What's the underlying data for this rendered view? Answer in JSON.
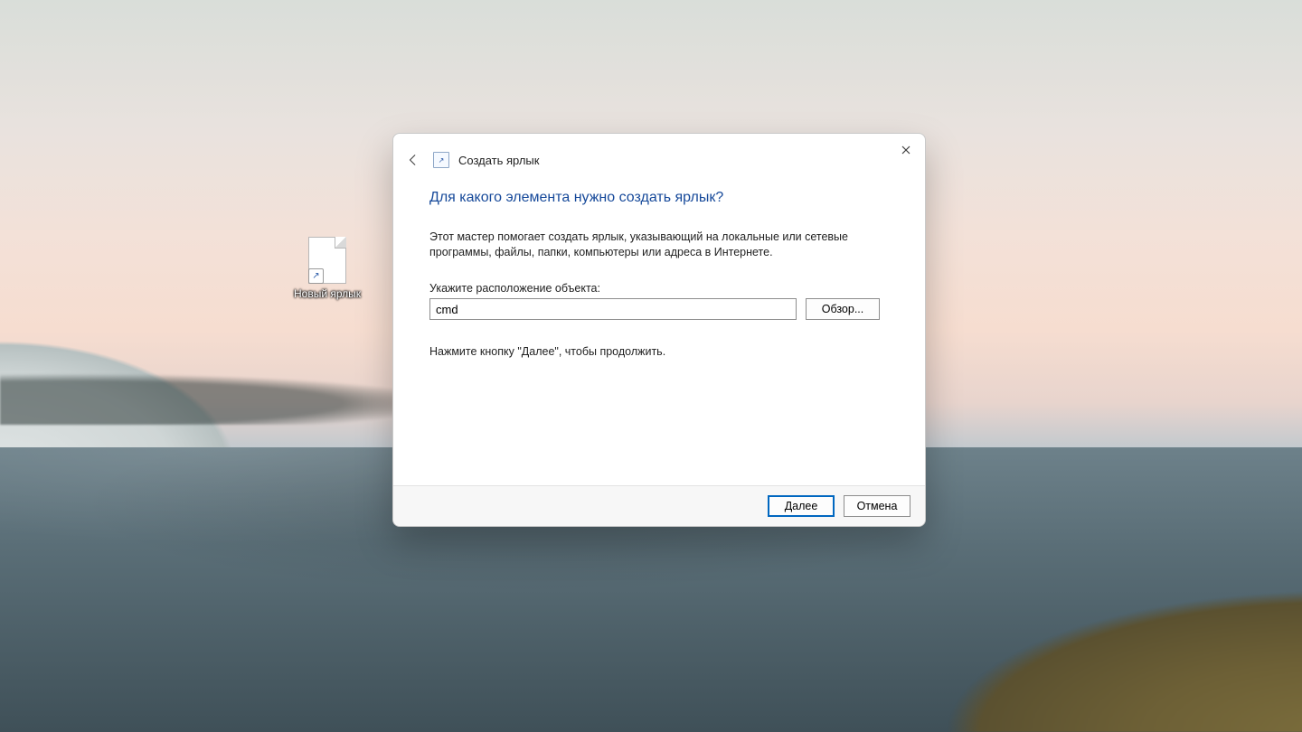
{
  "desktop": {
    "icon_label": "Новый ярлык"
  },
  "dialog": {
    "title": "Создать ярлык",
    "heading": "Для какого элемента нужно создать ярлык?",
    "description": "Этот мастер помогает создать ярлык, указывающий на локальные или сетевые программы, файлы, папки, компьютеры или адреса в Интернете.",
    "field_label": "Укажите расположение объекта:",
    "path_value": "cmd",
    "browse_label": "Обзор...",
    "hint": "Нажмите кнопку \"Далее\", чтобы продолжить.",
    "next_label": "Далее",
    "cancel_label": "Отмена"
  }
}
